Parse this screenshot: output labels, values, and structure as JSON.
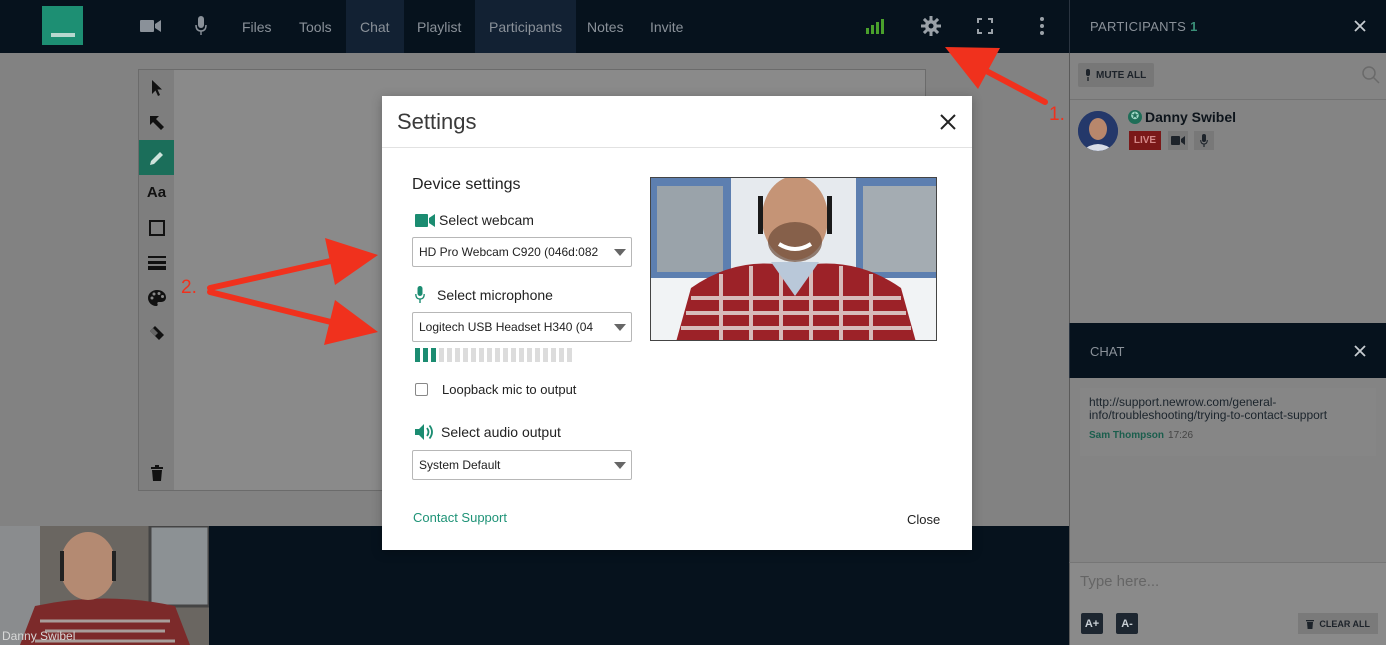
{
  "topbar": {
    "nav": [
      {
        "label": "Files",
        "active": false
      },
      {
        "label": "Tools",
        "active": false
      },
      {
        "label": "Chat",
        "active": true
      },
      {
        "label": "Playlist",
        "active": false
      },
      {
        "label": "Participants",
        "active": true
      },
      {
        "label": "Notes",
        "active": false
      },
      {
        "label": "Invite",
        "active": false
      }
    ],
    "icons": [
      "camera-icon",
      "microphone-icon",
      "signal-strength-icon",
      "gear-icon",
      "fullscreen-icon",
      "more-vertical-icon"
    ],
    "signal_color": "#4aa02c"
  },
  "participants_panel": {
    "title": "PARTICIPANTS",
    "count": "1",
    "mute_all": "MUTE ALL",
    "participants": [
      {
        "name": "Danny Swibel",
        "badge": "LIVE"
      }
    ]
  },
  "whiteboard": {
    "tools": [
      "select-arrow-icon",
      "pointer-arrow-icon",
      "pencil-icon",
      "text-tool-icon",
      "rectangle-icon",
      "line-width-icon",
      "palette-icon",
      "eraser-icon",
      "trash-icon"
    ],
    "text_tool_label": "Aa"
  },
  "video": {
    "name": "Danny Swibel"
  },
  "chat_panel": {
    "title": "CHAT",
    "messages": [
      {
        "text": "http://support.newrow.com/general-info/troubleshooting/trying-to-contact-support",
        "author": "Sam Thompson",
        "time": "17:26"
      }
    ],
    "input_placeholder": "Type here...",
    "font_increase": "A+",
    "font_decrease": "A-",
    "clear_all": "CLEAR ALL"
  },
  "annotations": {
    "label1": "1.",
    "label2": "2.",
    "color": "#f0311d"
  },
  "settings_modal": {
    "title": "Settings",
    "section": "Device settings",
    "webcam_label": "Select webcam",
    "webcam_value": "HD Pro Webcam C920 (046d:082",
    "mic_label": "Select microphone",
    "mic_value": "Logitech USB Headset H340 (04",
    "mic_level_active": 3,
    "mic_level_total": 20,
    "loopback_label": "Loopback mic to output",
    "loopback_checked": false,
    "audio_output_label": "Select audio output",
    "audio_output_value": "System Default",
    "contact_support": "Contact Support",
    "close": "Close",
    "accent_color": "#1b8c71"
  }
}
